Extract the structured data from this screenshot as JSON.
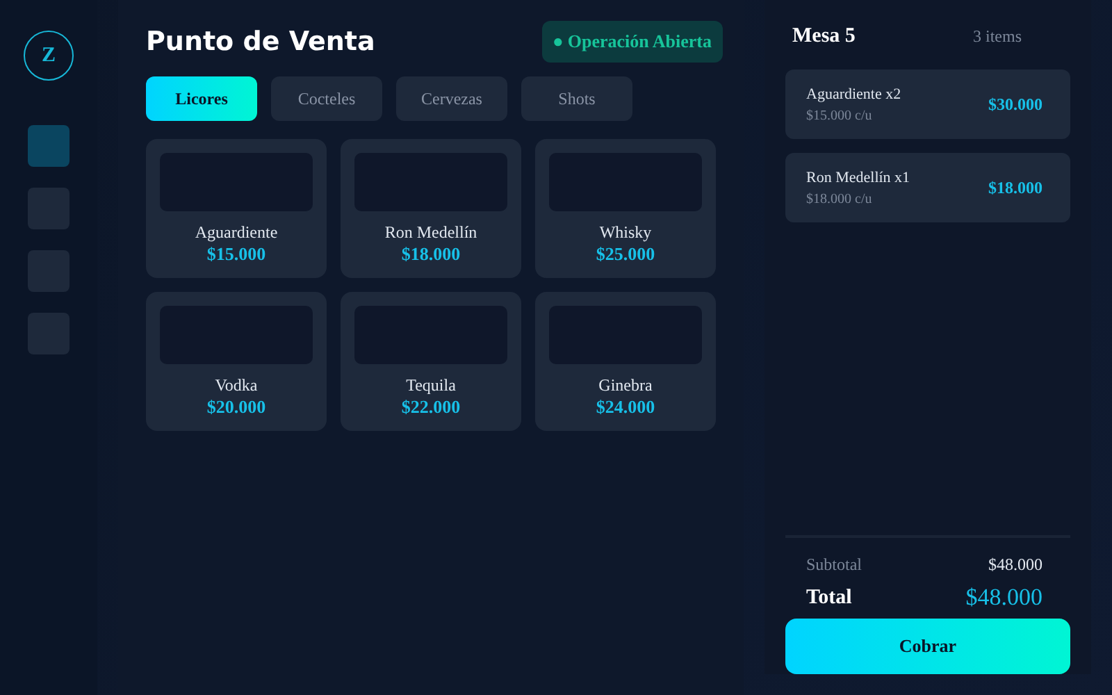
{
  "sidebar": {
    "logo": "Z",
    "items": [
      {
        "selected": true
      },
      {
        "selected": false
      },
      {
        "selected": false
      },
      {
        "selected": false
      }
    ]
  },
  "header": {
    "title": "Punto de Venta",
    "status": {
      "dot": "●",
      "label": "Operación Abierta"
    }
  },
  "tabs": [
    {
      "label": "Licores",
      "selected": true
    },
    {
      "label": "Cocteles",
      "selected": false
    },
    {
      "label": "Cervezas",
      "selected": false
    },
    {
      "label": "Shots",
      "selected": false
    }
  ],
  "products": [
    {
      "name": "Aguardiente",
      "price": "$15.000"
    },
    {
      "name": "Ron Medellín",
      "price": "$18.000"
    },
    {
      "name": "Whisky",
      "price": "$25.000"
    },
    {
      "name": "Vodka",
      "price": "$20.000"
    },
    {
      "name": "Tequila",
      "price": "$22.000"
    },
    {
      "name": "Ginebra",
      "price": "$24.000"
    }
  ],
  "order": {
    "title": "Mesa 5",
    "count": "3 items",
    "items": [
      {
        "name": "Aguardiente x2",
        "unit": "$15.000 c/u",
        "total": "$30.000"
      },
      {
        "name": "Ron Medellín x1",
        "unit": "$18.000 c/u",
        "total": "$18.000"
      }
    ],
    "subtotal_label": "Subtotal",
    "subtotal": "$48.000",
    "total_label": "Total",
    "total": "$48.000",
    "button": "Cobrar"
  }
}
